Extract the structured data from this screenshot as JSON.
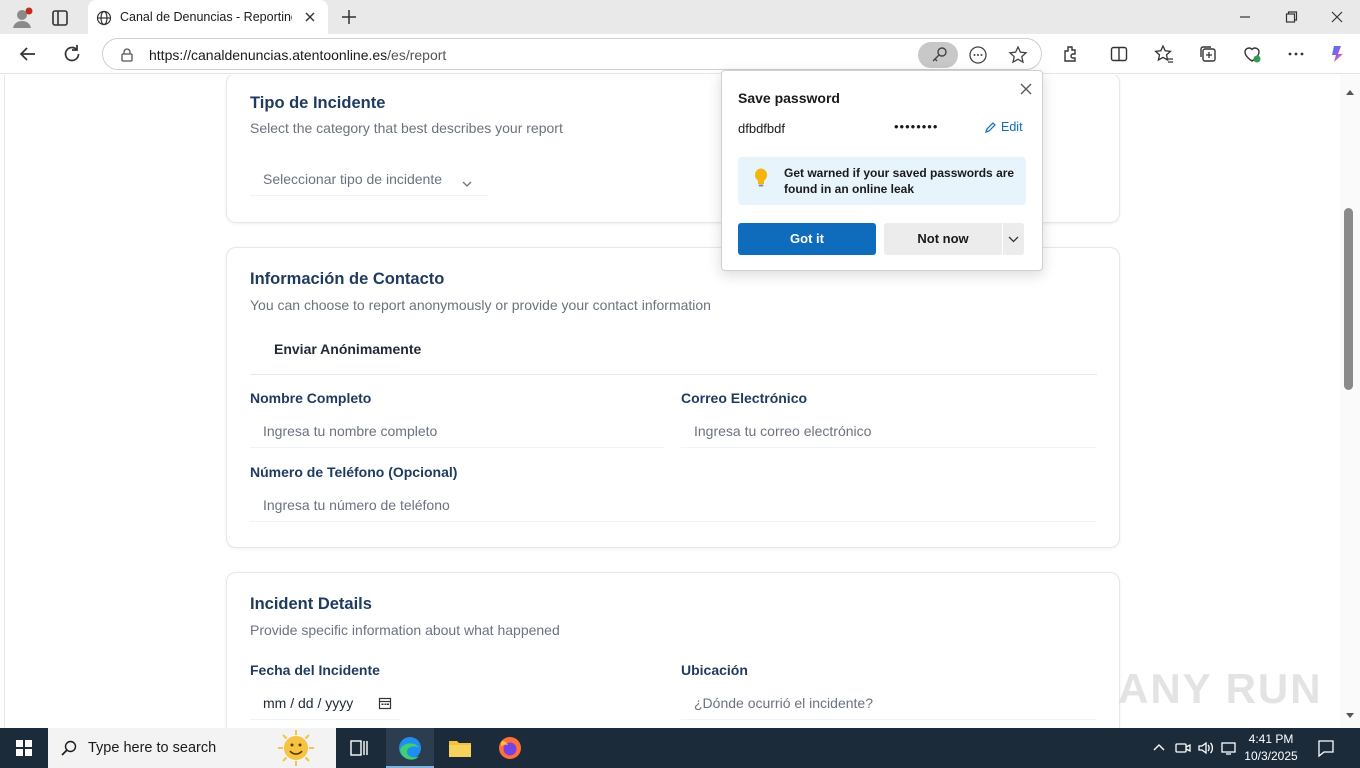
{
  "browser": {
    "tab_title": "Canal de Denuncias - Reporting C",
    "url_host": "https://canaldenuncias.atentoonline.es",
    "url_path": "/es/report"
  },
  "page": {
    "incident_type": {
      "title": "Tipo de Incidente",
      "subtitle": "Select the category that best describes your report",
      "select_placeholder": "Seleccionar tipo de incidente"
    },
    "contact": {
      "title": "Información de Contacto",
      "subtitle": "You can choose to report anonymously or provide your contact information",
      "anonymous_label": "Enviar Anónimamente",
      "name_label": "Nombre Completo",
      "name_placeholder": "Ingresa tu nombre completo",
      "email_label": "Correo Electrónico",
      "email_placeholder": "Ingresa tu correo electrónico",
      "phone_label": "Número de Teléfono (Opcional)",
      "phone_placeholder": "Ingresa tu número de teléfono"
    },
    "details": {
      "title": "Incident Details",
      "subtitle": "Provide specific information about what happened",
      "date_label": "Fecha del Incidente",
      "date_placeholder": "mm / dd / yyyy",
      "location_label": "Ubicación",
      "location_placeholder": "¿Dónde ocurrió el incidente?"
    }
  },
  "password_popup": {
    "title": "Save password",
    "username": "dfbdfbdf",
    "password_mask": "••••••••",
    "edit_label": "Edit",
    "info_text": "Get warned if your saved passwords are found in an online leak",
    "got_it_label": "Got it",
    "not_now_label": "Not now"
  },
  "watermark": {
    "text": "ANY RUN"
  },
  "taskbar": {
    "search_placeholder": "Type here to search",
    "time": "4:41 PM",
    "date": "10/3/2025"
  },
  "colors": {
    "accent": "#0f6cbd",
    "heading": "#1e3a5f",
    "taskbar": "#1c2b3a"
  }
}
